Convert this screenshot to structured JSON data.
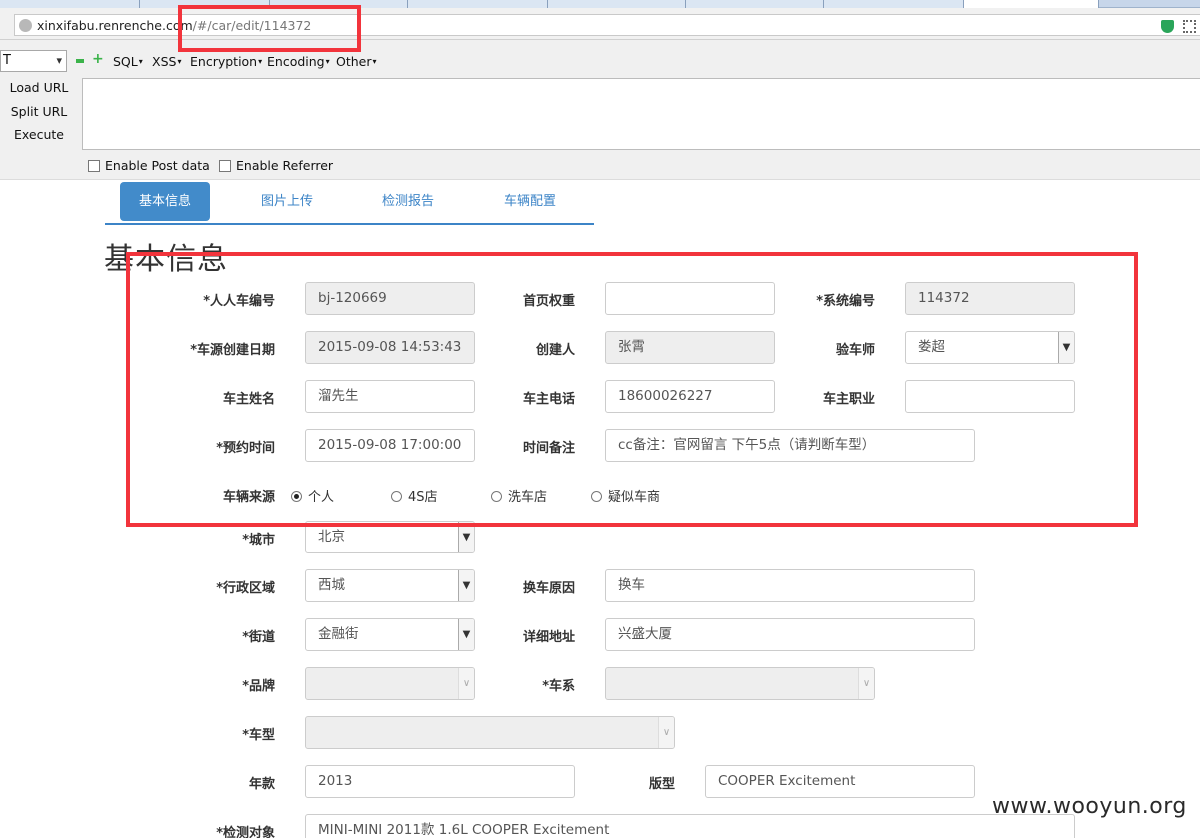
{
  "browser": {
    "url_host": "xinxifabu.renrenche.com",
    "url_path": "/#/car/edit/114372"
  },
  "hackbar": {
    "method": "T",
    "menus": [
      "SQL",
      "XSS",
      "Encryption",
      "Encoding",
      "Other"
    ],
    "actions": [
      "Load URL",
      "Split URL",
      "Execute"
    ],
    "enable_post": "Enable Post data",
    "enable_referrer": "Enable Referrer"
  },
  "tabs": [
    "基本信息",
    "图片上传",
    "检测报告",
    "车辆配置"
  ],
  "section_title": "基本信息",
  "form": {
    "renren_id": {
      "label": "*人人车编号",
      "value": "bj-120669"
    },
    "home_weight": {
      "label": "首页权重",
      "value": ""
    },
    "system_id": {
      "label": "*系统编号",
      "value": "114372"
    },
    "created_date": {
      "label": "*车源创建日期",
      "value": "2015-09-08 14:53:43"
    },
    "creator": {
      "label": "创建人",
      "value": "张霄"
    },
    "inspector": {
      "label": "验车师",
      "value": "娄超"
    },
    "owner_name": {
      "label": "车主姓名",
      "value": "溜先生"
    },
    "owner_phone": {
      "label": "车主电话",
      "value": "18600026227"
    },
    "owner_job": {
      "label": "车主职业",
      "value": ""
    },
    "appointment": {
      "label": "*预约时间",
      "value": "2015-09-08 17:00:00"
    },
    "time_note": {
      "label": "时间备注",
      "value": "cc备注：官网留言 下午5点（请判断车型）"
    },
    "source": {
      "label": "车辆来源",
      "options": [
        "个人",
        "4S店",
        "洗车店",
        "疑似车商"
      ],
      "selected": "个人"
    },
    "city": {
      "label": "*城市",
      "value": "北京"
    },
    "district": {
      "label": "*行政区域",
      "value": "西城"
    },
    "change_reason": {
      "label": "换车原因",
      "value": "换车"
    },
    "street": {
      "label": "*街道",
      "value": "金融街"
    },
    "address": {
      "label": "详细地址",
      "value": "兴盛大厦"
    },
    "brand": {
      "label": "*品牌",
      "value": ""
    },
    "series": {
      "label": "*车系",
      "value": ""
    },
    "model": {
      "label": "*车型",
      "value": ""
    },
    "year": {
      "label": "年款",
      "value": "2013"
    },
    "version": {
      "label": "版型",
      "value": "COOPER Excitement"
    },
    "inspect_target": {
      "label": "*检测对象",
      "value": "MINI-MINI 2011款 1.6L COOPER Excitement"
    }
  },
  "watermark": "www.wooyun.org",
  "colors": {
    "accent": "#428bca",
    "annotation": "#f2343c"
  }
}
